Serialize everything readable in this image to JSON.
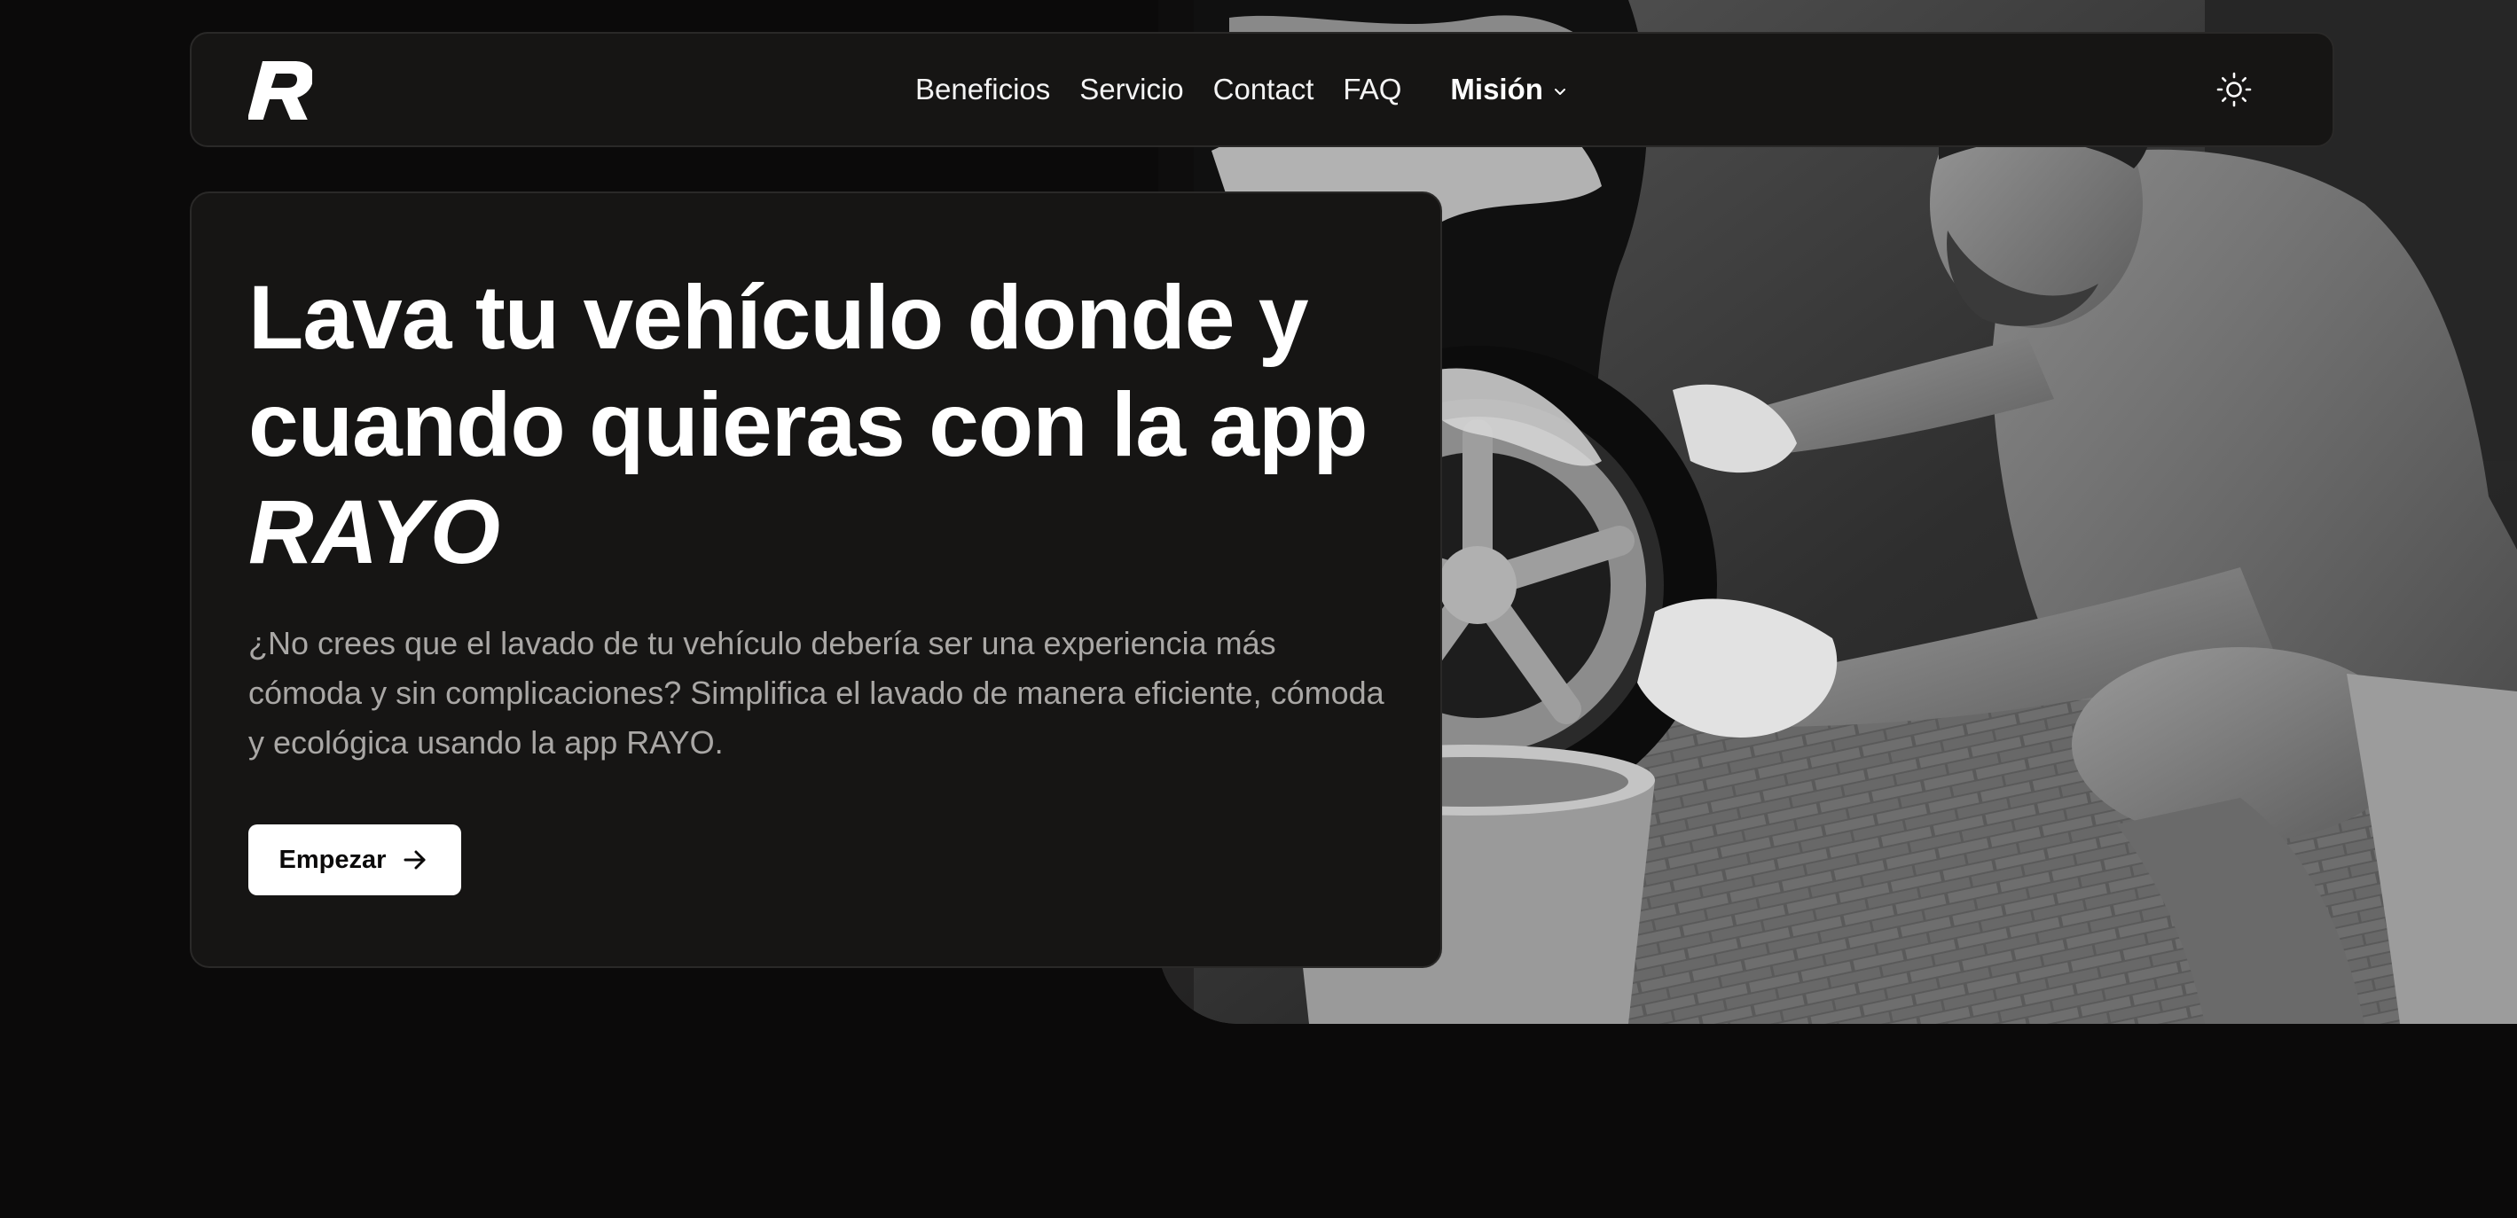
{
  "nav": {
    "logo_letter": "R",
    "links": [
      "Beneficios",
      "Servicio",
      "Contact",
      "FAQ"
    ],
    "dropdown_label": "Misión",
    "theme_icon": "sun-icon"
  },
  "hero": {
    "title_line1": "Lava tu vehículo donde y",
    "title_line2": "cuando quieras con la app",
    "title_brand": "RAYO",
    "description": "¿No crees que el lavado de tu vehículo debería ser una experiencia más cómoda y sin complicaciones? Simplifica el lavado de manera eficiente, cómoda y ecológica usando la app RAYO.",
    "cta_label": "Empezar",
    "cta_icon": "arrow-right-icon",
    "image_subject": "man-washing-car-wheel-photo"
  },
  "colors": {
    "background": "#0b0a0a",
    "card": "#161514",
    "card_border": "#2a2928",
    "text_primary": "#ffffff",
    "text_secondary": "#a9a7a5",
    "button_bg": "#ffffff",
    "button_text": "#0b0a0a"
  }
}
